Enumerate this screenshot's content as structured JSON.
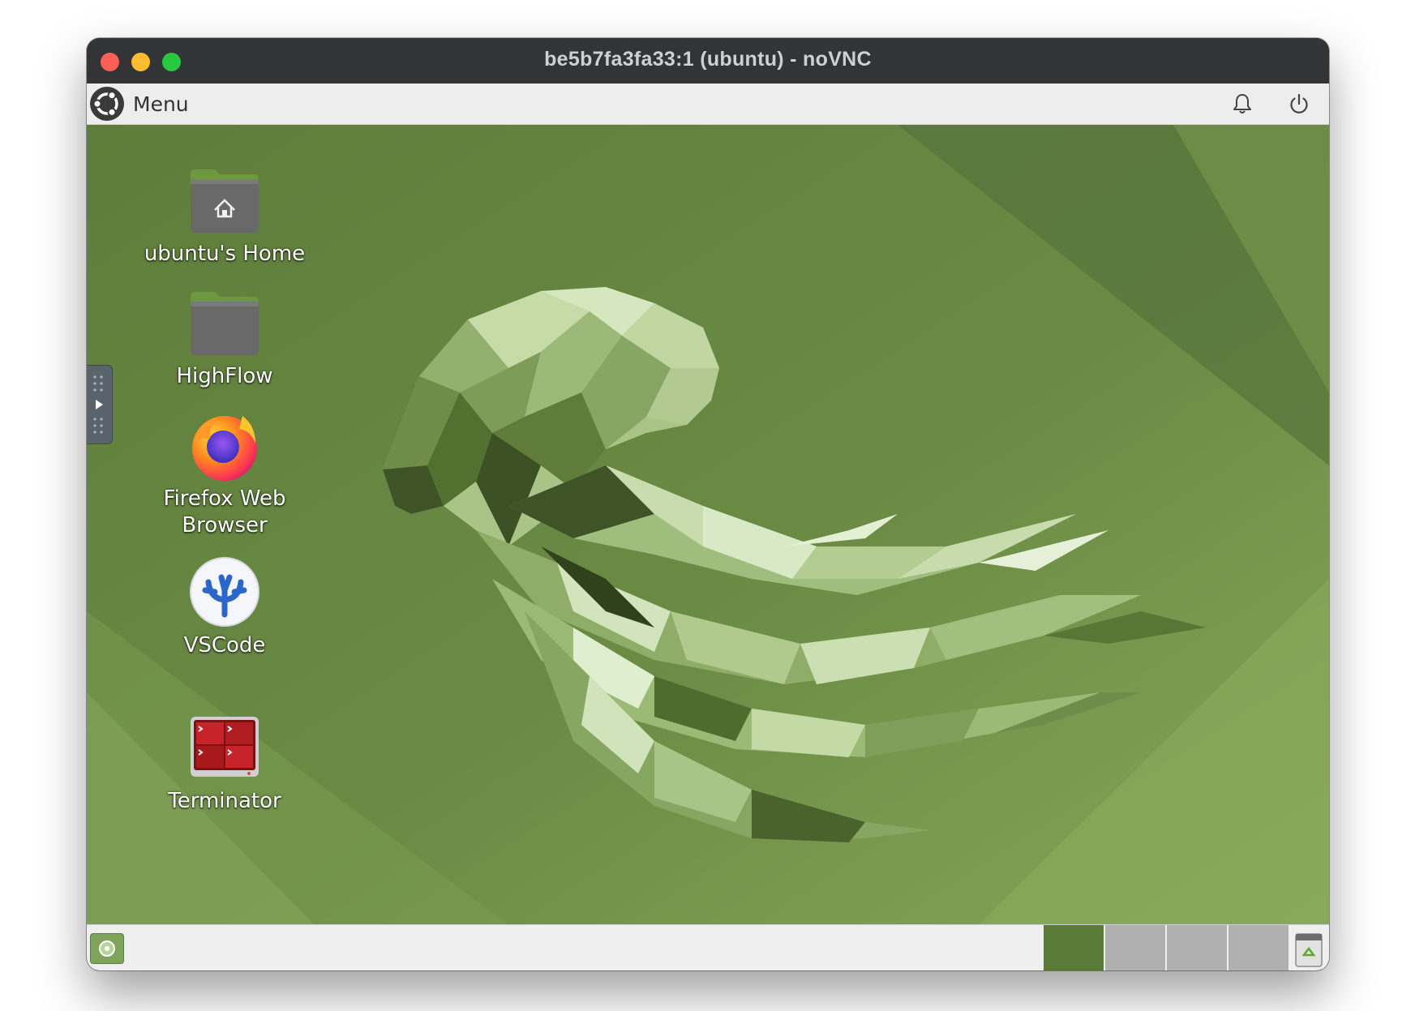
{
  "window": {
    "title": "be5b7fa3fa33:1 (ubuntu) - noVNC"
  },
  "topbar": {
    "menu_label": "Menu",
    "menu_icon": "ubuntu-logo-icon",
    "notifications_icon": "bell-icon",
    "power_icon": "power-icon"
  },
  "desktop": {
    "wallpaper": "green low-poly jellyfish",
    "icons": [
      {
        "label": "ubuntu's Home",
        "icon": "home-folder-icon"
      },
      {
        "label": "HighFlow",
        "icon": "folder-icon"
      },
      {
        "label": "Firefox Web Browser",
        "icon": "firefox-icon"
      },
      {
        "label": "VSCode",
        "icon": "vscode-icon"
      },
      {
        "label": "Terminator",
        "icon": "terminator-icon"
      }
    ]
  },
  "taskbar": {
    "show_desktop_icon": "show-desktop-icon",
    "workspaces": [
      "workspace-1",
      "workspace-2",
      "workspace-3",
      "workspace-4"
    ],
    "active_workspace": 1,
    "trash_icon": "trash-icon"
  },
  "colors": {
    "desktop_green": "#6a8a45",
    "titlebar": "#323436",
    "close": "#fe5f57",
    "minimize": "#febc2e",
    "maximize": "#28c840"
  }
}
